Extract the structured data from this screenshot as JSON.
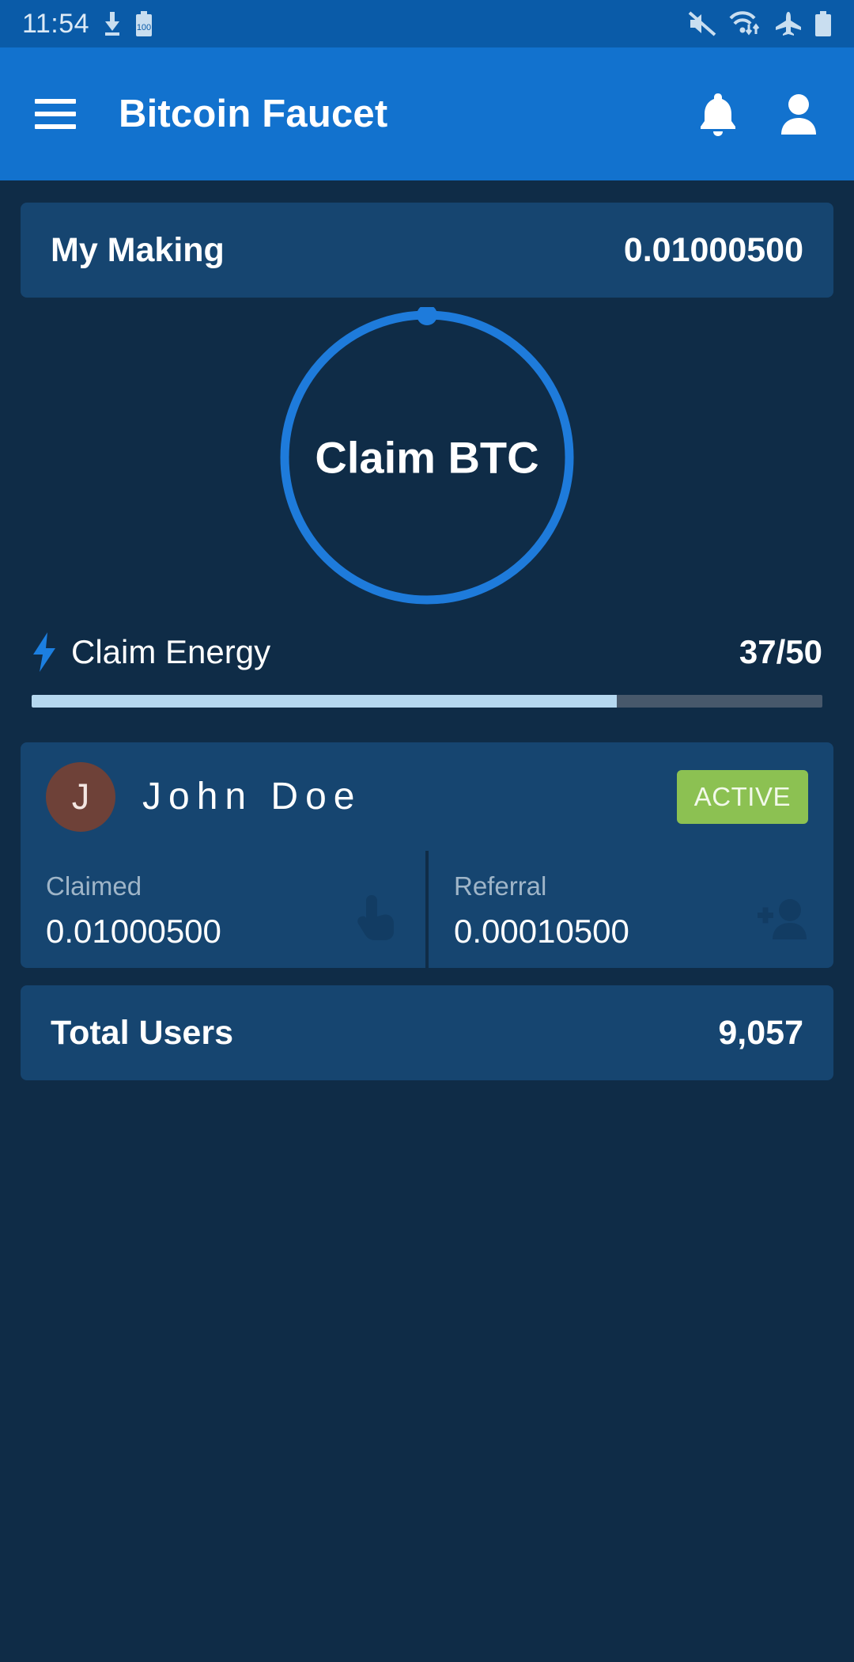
{
  "status_bar": {
    "time": "11:54",
    "left_icons": [
      "download-icon",
      "battery-saver-100-icon"
    ],
    "right_icons": [
      "volume-mute-icon",
      "wifi-transfer-icon",
      "airplane-mode-icon",
      "battery-full-icon"
    ],
    "background_color": "#0A5BA8"
  },
  "app_bar": {
    "title": "Bitcoin Faucet",
    "menu_icon": "hamburger-menu-icon",
    "notification_icon": "bell-icon",
    "account_icon": "person-icon",
    "background_color": "#1272CE"
  },
  "my_making": {
    "label": "My Making",
    "value": "0.01000500"
  },
  "claim": {
    "button_label": "Claim BTC",
    "ring_color": "#1E7BDB",
    "knob_angle_deg": 0
  },
  "claim_energy": {
    "icon": "lightning-bolt-icon",
    "label": "Claim Energy",
    "current": 37,
    "max": 50,
    "count_text": "37/50",
    "percent": 74,
    "fill_color": "#B5D8F0",
    "track_color": "#47586B"
  },
  "user": {
    "avatar_initial": "J",
    "avatar_color": "#6E4138",
    "name": "John Doe",
    "status_badge": "ACTIVE",
    "status_color": "#8CC152"
  },
  "stats": [
    {
      "label": "Claimed",
      "value": "0.01000500",
      "icon": "touch-tap-icon"
    },
    {
      "label": "Referral",
      "value": "0.00010500",
      "icon": "person-add-icon"
    }
  ],
  "total_users": {
    "label": "Total Users",
    "value": "9,057"
  },
  "theme": {
    "page_background": "#0F2C47",
    "card_background": "#164570",
    "accent": "#1272CE"
  }
}
